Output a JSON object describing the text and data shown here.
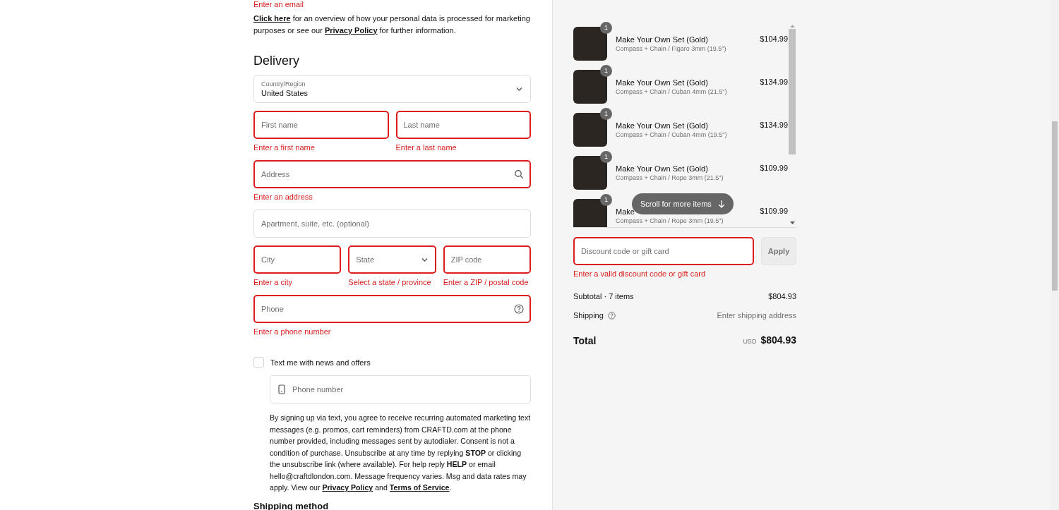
{
  "contact": {
    "email_error": "Enter an email",
    "notice": [
      {
        "kind": "link",
        "text": "Click here"
      },
      {
        "kind": "text",
        "text": " for an overview of how your personal data is processed for marketing purposes or see our "
      },
      {
        "kind": "link",
        "text": "Privacy Policy"
      },
      {
        "kind": "text",
        "text": " for further information."
      }
    ]
  },
  "delivery": {
    "heading": "Delivery",
    "country": {
      "label": "Country/Region",
      "value": "United States"
    },
    "rows": [
      [
        {
          "kind": "text",
          "placeholder": "First name",
          "error": "Enter a first name"
        },
        {
          "kind": "text",
          "placeholder": "Last name",
          "error": "Enter a last name"
        }
      ],
      [
        {
          "kind": "search",
          "placeholder": "Address",
          "error": "Enter an address"
        }
      ],
      [
        {
          "kind": "text",
          "placeholder": "Apartment, suite, etc. (optional)"
        }
      ],
      [
        {
          "kind": "text",
          "placeholder": "City",
          "error": "Enter a city"
        },
        {
          "kind": "select",
          "placeholder": "State",
          "error": "Select a state / province"
        },
        {
          "kind": "text",
          "placeholder": "ZIP code",
          "error": "Enter a ZIP / postal code"
        }
      ],
      [
        {
          "kind": "help",
          "placeholder": "Phone",
          "error": "Enter a phone number"
        }
      ]
    ]
  },
  "sms": {
    "label": "Text me with news and offers",
    "checked": false,
    "phone_placeholder": "Phone number",
    "consent": [
      {
        "kind": "text",
        "text": "By signing up via text, you agree to receive recurring automated marketing text messages (e.g. promos, cart reminders) from CRAFTD.com at the phone number provided, including messages sent by autodialer. Consent is not a condition of purchase. Unsubscribe at any time by replying **STOP** or clicking the unsubscribe link (where available). For help reply **HELP** or email hello@craftdlondon.com. Message frequency varies. Msg and data rates may apply. View our "
      },
      {
        "kind": "link",
        "text": "Privacy Policy"
      },
      {
        "kind": "text",
        "text": " and "
      },
      {
        "kind": "link",
        "text": "Terms of Service"
      },
      {
        "kind": "text",
        "text": "."
      }
    ]
  },
  "shipping_method": {
    "heading": "Shipping method"
  },
  "order": {
    "items": [
      {
        "name": "Make Your Own Set (Gold)",
        "variant": "Compass + Chain / Figaro 3mm (19.5\")",
        "price": "$104.99",
        "quantity": "1"
      },
      {
        "name": "Make Your Own Set (Gold)",
        "variant": "Compass + Chain / Cuban 4mm (21.5\")",
        "price": "$134.99",
        "quantity": "1"
      },
      {
        "name": "Make Your Own Set (Gold)",
        "variant": "Compass + Chain / Cuban 4mm (19.5\")",
        "price": "$134.99",
        "quantity": "1"
      },
      {
        "name": "Make Your Own Set (Gold)",
        "variant": "Compass + Chain / Rope 3mm (21.5\")",
        "price": "$109.99",
        "quantity": "1"
      },
      {
        "name": "Make",
        "variant": "Compass + Chain / Rope 3mm (19.5\")",
        "price": "$109.99",
        "quantity": "1"
      }
    ],
    "scroll_hint": "Scroll for more items",
    "discount": {
      "placeholder": "Discount code or gift card",
      "error": "Enter a valid discount code or gift card",
      "button": "Apply"
    },
    "subtotal": {
      "label": "Subtotal · 7 items",
      "value": "$804.93"
    },
    "shipping": {
      "label": "Shipping",
      "value": "Enter shipping address"
    },
    "total": {
      "label": "Total",
      "currency": "USD",
      "value": "$804.93"
    }
  }
}
